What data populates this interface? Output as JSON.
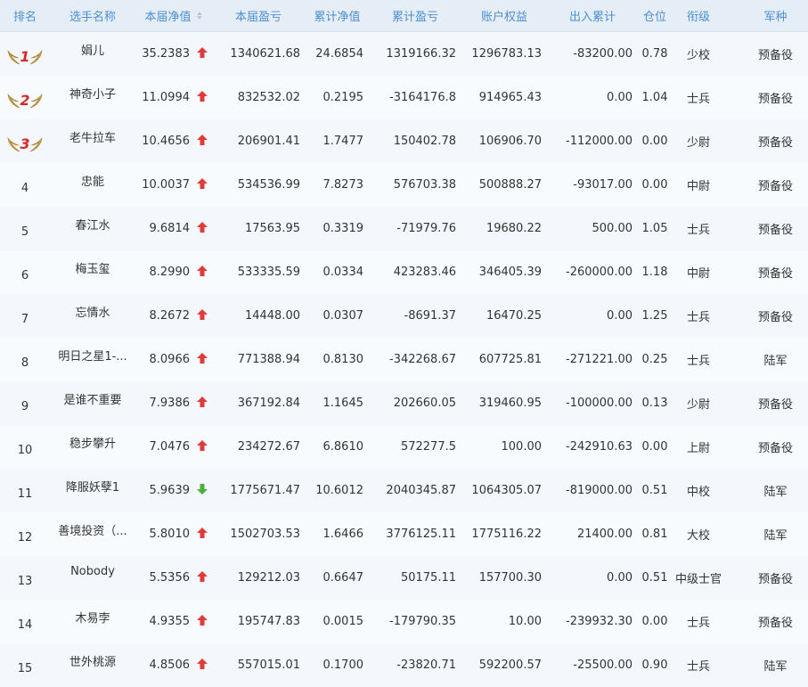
{
  "columns": {
    "rank": "排名",
    "name": "选手名称",
    "nav": "本届净值",
    "profit": "本届盈亏",
    "cum_nav": "累计净值",
    "cum_profit": "累计盈亏",
    "equity": "账户权益",
    "inout": "出入累计",
    "position": "仓位",
    "title": "衔级",
    "branch": "军种"
  },
  "colors": {
    "up": "#e03a3a",
    "down": "#4caf3a",
    "header_text": "#4d8fd1",
    "medal_gold": "#c9a04a"
  },
  "rows": [
    {
      "rank": "1",
      "name": "娟儿",
      "nav": "35.2383",
      "trend": "up",
      "profit": "1340621.68",
      "cum_nav": "24.6854",
      "cum_profit": "1319166.32",
      "equity": "1296783.13",
      "inout": "-83200.00",
      "position": "0.78",
      "title": "少校",
      "branch": "预备役"
    },
    {
      "rank": "2",
      "name": "神奇小子",
      "nav": "11.0994",
      "trend": "up",
      "profit": "832532.02",
      "cum_nav": "0.2195",
      "cum_profit": "-3164176.8",
      "equity": "914965.43",
      "inout": "0.00",
      "position": "1.04",
      "title": "士兵",
      "branch": "预备役"
    },
    {
      "rank": "3",
      "name": "老牛拉车",
      "nav": "10.4656",
      "trend": "up",
      "profit": "206901.41",
      "cum_nav": "1.7477",
      "cum_profit": "150402.78",
      "equity": "106906.70",
      "inout": "-112000.00",
      "position": "0.00",
      "title": "少尉",
      "branch": "预备役"
    },
    {
      "rank": "4",
      "name": "忠能",
      "nav": "10.0037",
      "trend": "up",
      "profit": "534536.99",
      "cum_nav": "7.8273",
      "cum_profit": "576703.38",
      "equity": "500888.27",
      "inout": "-93017.00",
      "position": "0.00",
      "title": "中尉",
      "branch": "预备役"
    },
    {
      "rank": "5",
      "name": "春江水",
      "nav": "9.6814",
      "trend": "up",
      "profit": "17563.95",
      "cum_nav": "0.3319",
      "cum_profit": "-71979.76",
      "equity": "19680.22",
      "inout": "500.00",
      "position": "1.05",
      "title": "士兵",
      "branch": "预备役"
    },
    {
      "rank": "6",
      "name": "梅玉玺",
      "nav": "8.2990",
      "trend": "up",
      "profit": "533335.59",
      "cum_nav": "0.0334",
      "cum_profit": "423283.46",
      "equity": "346405.39",
      "inout": "-260000.00",
      "position": "1.18",
      "title": "中尉",
      "branch": "预备役"
    },
    {
      "rank": "7",
      "name": "忘情水",
      "nav": "8.2672",
      "trend": "up",
      "profit": "14448.00",
      "cum_nav": "0.0307",
      "cum_profit": "-8691.37",
      "equity": "16470.25",
      "inout": "0.00",
      "position": "1.25",
      "title": "士兵",
      "branch": "预备役"
    },
    {
      "rank": "8",
      "name": "明日之星1-...",
      "nav": "8.0966",
      "trend": "up",
      "profit": "771388.94",
      "cum_nav": "0.8130",
      "cum_profit": "-342268.67",
      "equity": "607725.81",
      "inout": "-271221.00",
      "position": "0.25",
      "title": "士兵",
      "branch": "陆军"
    },
    {
      "rank": "9",
      "name": "是谁不重要",
      "nav": "7.9386",
      "trend": "up",
      "profit": "367192.84",
      "cum_nav": "1.1645",
      "cum_profit": "202660.05",
      "equity": "319460.95",
      "inout": "-100000.00",
      "position": "0.13",
      "title": "少尉",
      "branch": "预备役"
    },
    {
      "rank": "10",
      "name": "稳步攀升",
      "nav": "7.0476",
      "trend": "up",
      "profit": "234272.67",
      "cum_nav": "6.8610",
      "cum_profit": "572277.5",
      "equity": "100.00",
      "inout": "-242910.63",
      "position": "0.00",
      "title": "上尉",
      "branch": "预备役"
    },
    {
      "rank": "11",
      "name": "降服妖孽1",
      "nav": "5.9639",
      "trend": "down",
      "profit": "1775671.47",
      "cum_nav": "10.6012",
      "cum_profit": "2040345.87",
      "equity": "1064305.07",
      "inout": "-819000.00",
      "position": "0.51",
      "title": "中校",
      "branch": "陆军"
    },
    {
      "rank": "12",
      "name": "善境投资（...",
      "nav": "5.8010",
      "trend": "up",
      "profit": "1502703.53",
      "cum_nav": "1.6466",
      "cum_profit": "3776125.11",
      "equity": "1775116.22",
      "inout": "21400.00",
      "position": "0.81",
      "title": "大校",
      "branch": "陆军"
    },
    {
      "rank": "13",
      "name": "Nobody",
      "nav": "5.5356",
      "trend": "up",
      "profit": "129212.03",
      "cum_nav": "0.6647",
      "cum_profit": "50175.11",
      "equity": "157700.30",
      "inout": "0.00",
      "position": "0.51",
      "title": "中级士官",
      "branch": "预备役"
    },
    {
      "rank": "14",
      "name": "木易孛",
      "nav": "4.9355",
      "trend": "up",
      "profit": "195747.83",
      "cum_nav": "0.0015",
      "cum_profit": "-179790.35",
      "equity": "10.00",
      "inout": "-239932.30",
      "position": "0.00",
      "title": "士兵",
      "branch": "预备役"
    },
    {
      "rank": "15",
      "name": "世外桃源",
      "nav": "4.8506",
      "trend": "up",
      "profit": "557015.01",
      "cum_nav": "0.1700",
      "cum_profit": "-23820.71",
      "equity": "592200.57",
      "inout": "-25500.00",
      "position": "0.90",
      "title": "士兵",
      "branch": "陆军"
    }
  ]
}
